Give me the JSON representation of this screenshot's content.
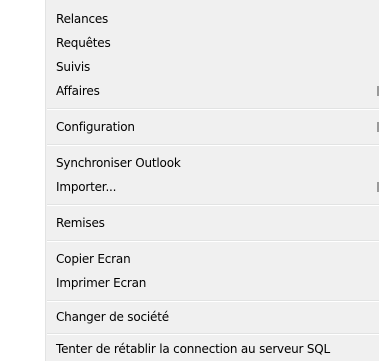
{
  "menu": {
    "relances": "Relances",
    "requetes": "Requêtes",
    "suivis": "Suivis",
    "affaires": "Affaires",
    "configuration": "Configuration",
    "synchroniser_outlook": "Synchroniser Outlook",
    "importer": "Importer...",
    "remises": "Remises",
    "copier_ecran": "Copier Ecran",
    "imprimer_ecran": "Imprimer Ecran",
    "changer_societe": "Changer de société",
    "retablir_connexion": "Tenter de rétablir la connection au serveur SQL"
  }
}
